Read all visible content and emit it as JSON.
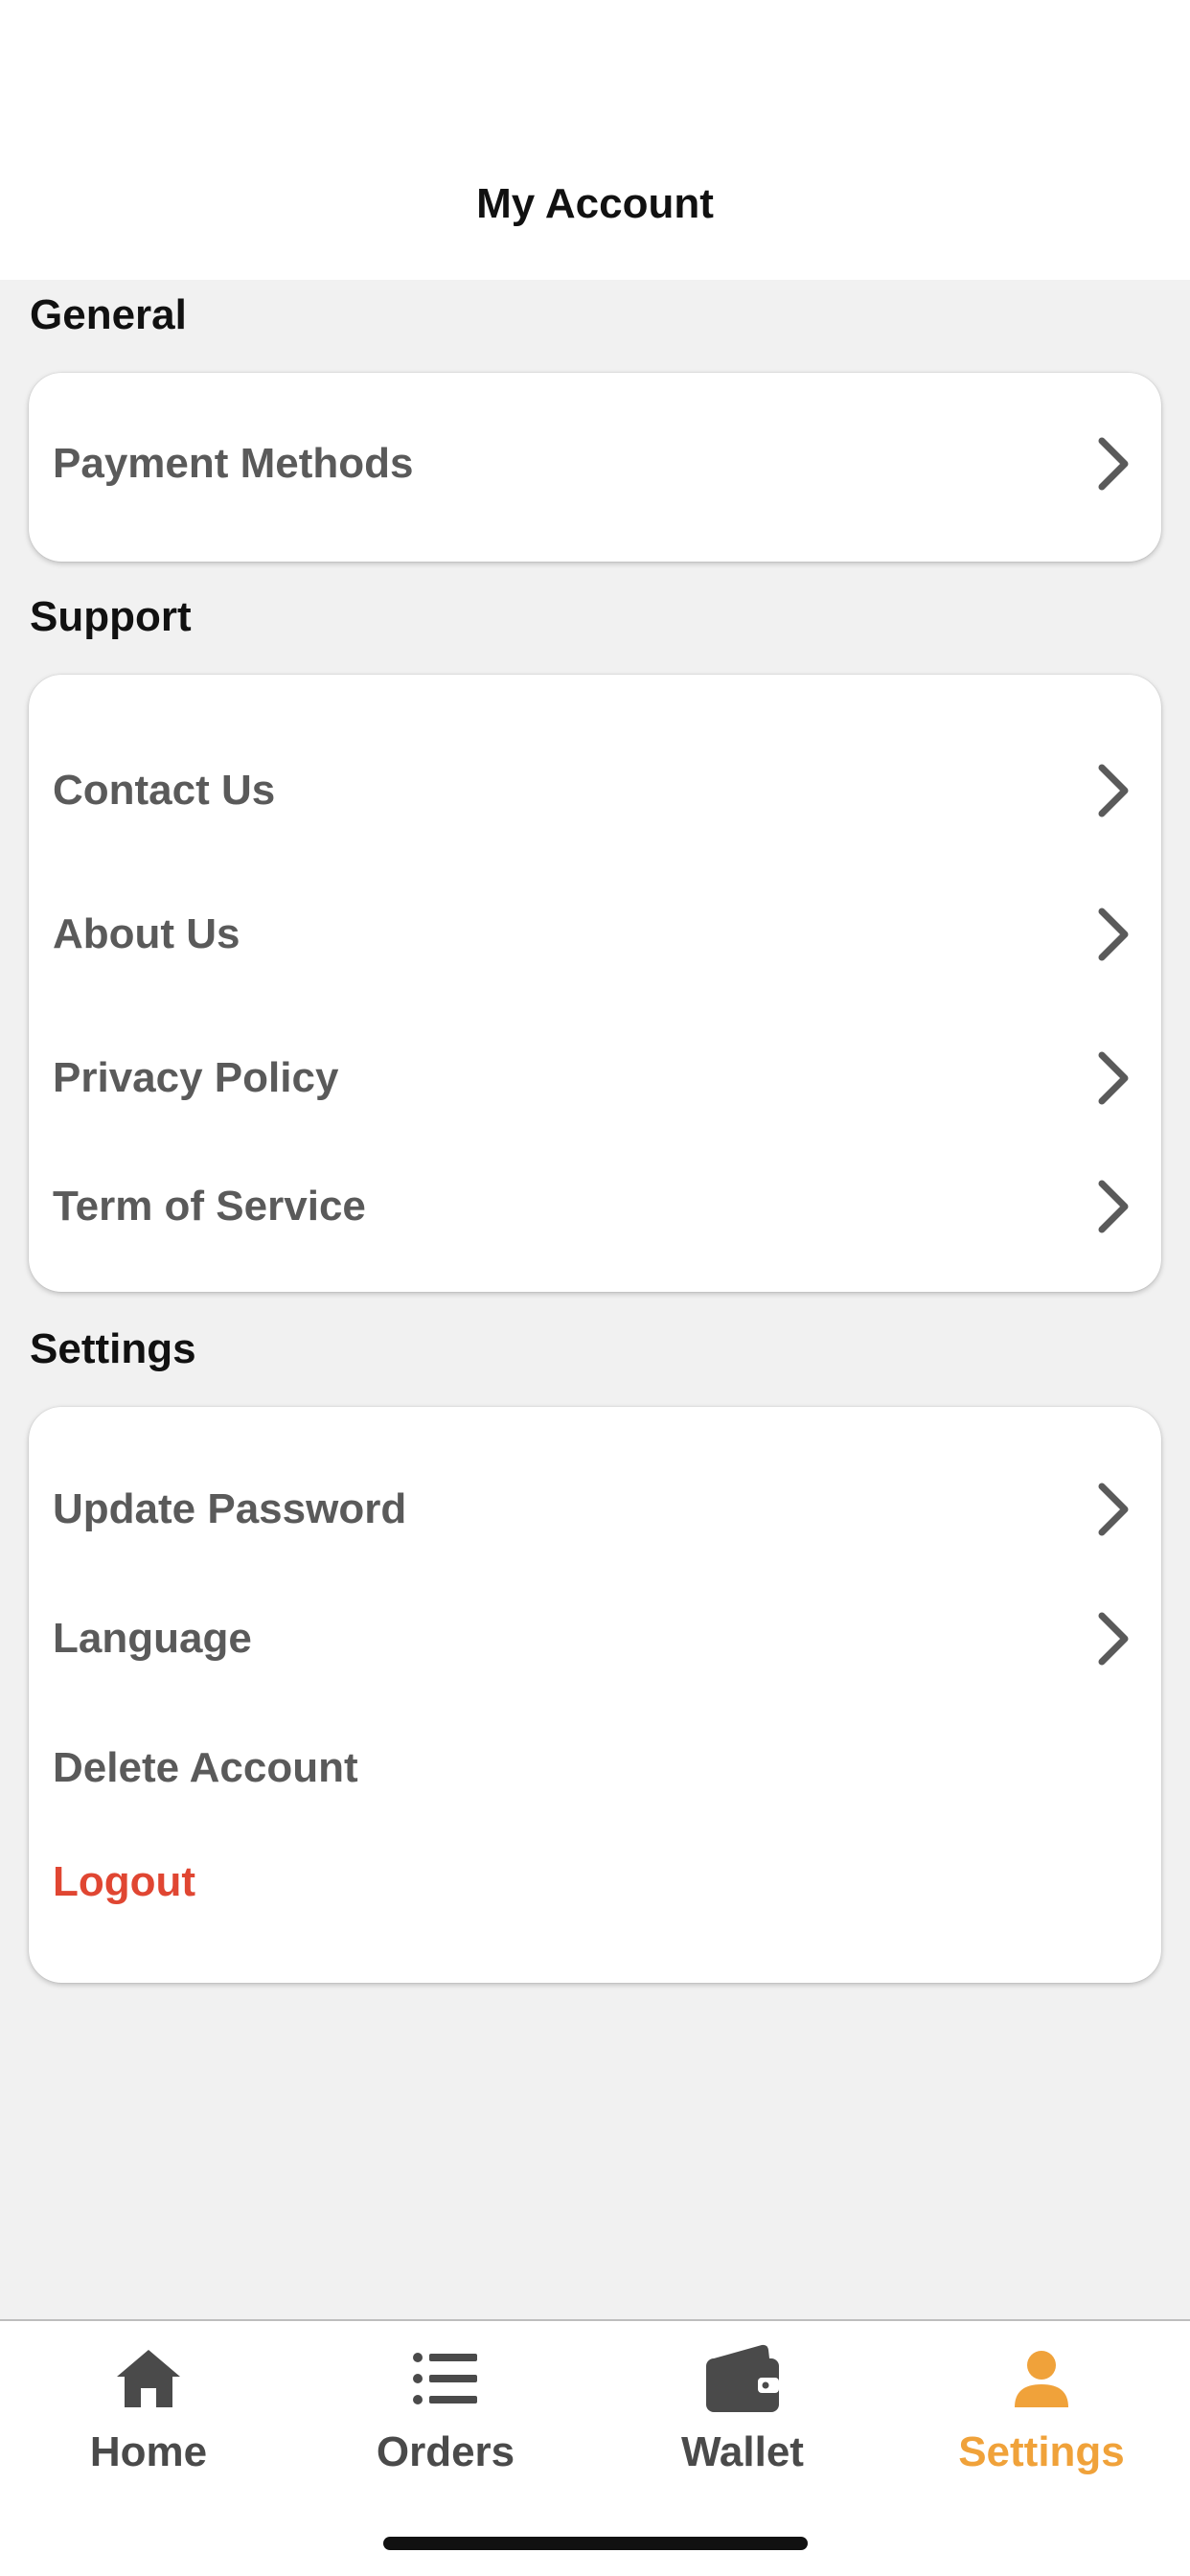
{
  "header": {
    "title": "My Account"
  },
  "sections": {
    "general": {
      "title": "General",
      "items": [
        {
          "label": "Payment Methods",
          "icon": "chevron-right-icon"
        }
      ]
    },
    "support": {
      "title": "Support",
      "items": [
        {
          "label": "Contact Us",
          "icon": "chevron-right-icon"
        },
        {
          "label": "About Us",
          "icon": "chevron-right-icon"
        },
        {
          "label": "Privacy Policy",
          "icon": "chevron-right-icon"
        },
        {
          "label": "Term of Service",
          "icon": "chevron-right-icon"
        }
      ]
    },
    "settings": {
      "title": "Settings",
      "items": [
        {
          "label": "Update Password",
          "icon": "chevron-right-icon"
        },
        {
          "label": "Language",
          "icon": "chevron-right-icon"
        },
        {
          "label": "Delete Account"
        },
        {
          "label": "Logout"
        }
      ]
    }
  },
  "tabbar": {
    "tabs": [
      {
        "label": "Home",
        "icon": "home-icon"
      },
      {
        "label": "Orders",
        "icon": "list-icon"
      },
      {
        "label": "Wallet",
        "icon": "wallet-icon"
      },
      {
        "label": "Settings",
        "icon": "person-icon",
        "active": true
      }
    ]
  },
  "colors": {
    "accent": "#f0a23a",
    "danger": "#e04632",
    "text_primary": "#111111",
    "text_secondary": "#5a5a5a",
    "background": "#f1f1f1"
  }
}
